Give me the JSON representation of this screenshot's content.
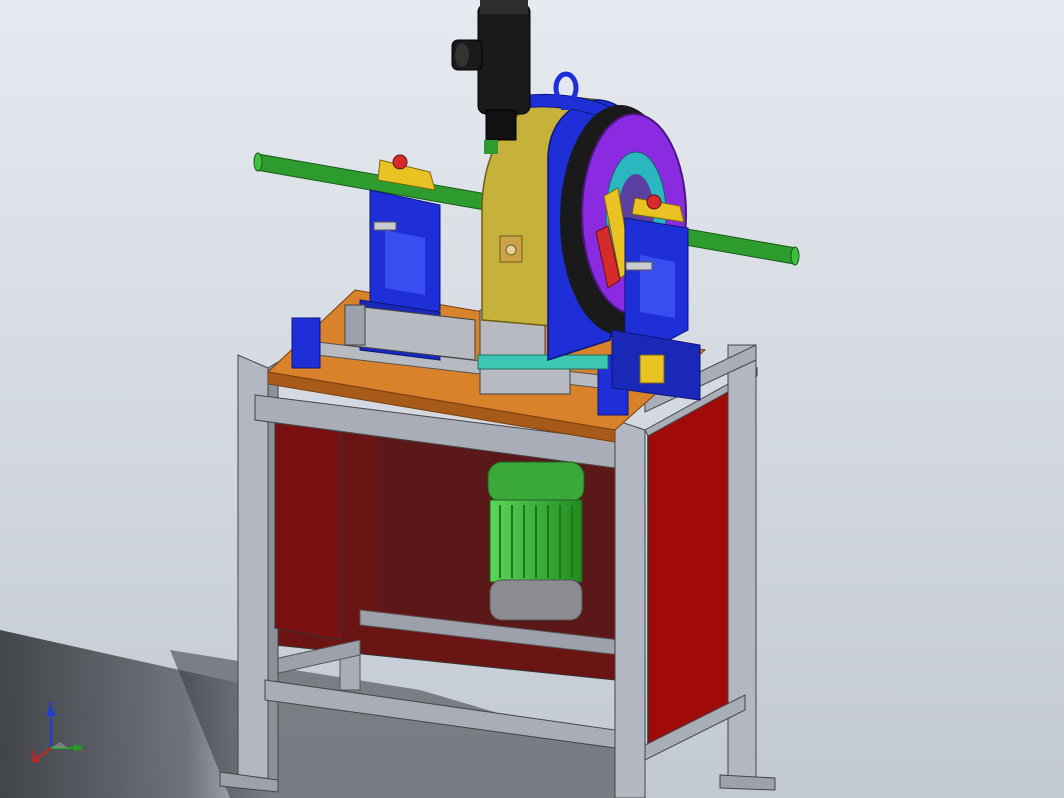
{
  "viewport": {
    "background_top": "#e4e8ee",
    "background_bottom": "#c9cfd8",
    "floor_shadow": "#2a2d31"
  },
  "colors": {
    "frame_steel": "#a9adb8",
    "frame_steel_dark": "#6c7079",
    "guard_panel_red": "#9c0a0a",
    "guard_panel_red_dark": "#5c1a1a",
    "bed_plate_orange": "#d8822c",
    "bed_plate_edge": "#a85a1a",
    "clamp_blue": "#1f2fd8",
    "clamp_blue_dark": "#10208e",
    "housing_yellow": "#c6b13b",
    "ring_purple": "#8a2be2",
    "tube_green": "#2e9b2e",
    "motor_green": "#3bc43b",
    "motor_grey": "#8b8d91",
    "gearmotor_black": "#1a1a1a",
    "clamp_jaw_yellow": "#e8c323",
    "clamp_pad_red": "#d62b2b"
  },
  "triad": {
    "x_label": "X",
    "y_label": "Y",
    "z_label": "Z",
    "x_color": "#d21f1f",
    "y_color": "#1fa31f",
    "z_color": "#1f3fd2"
  }
}
